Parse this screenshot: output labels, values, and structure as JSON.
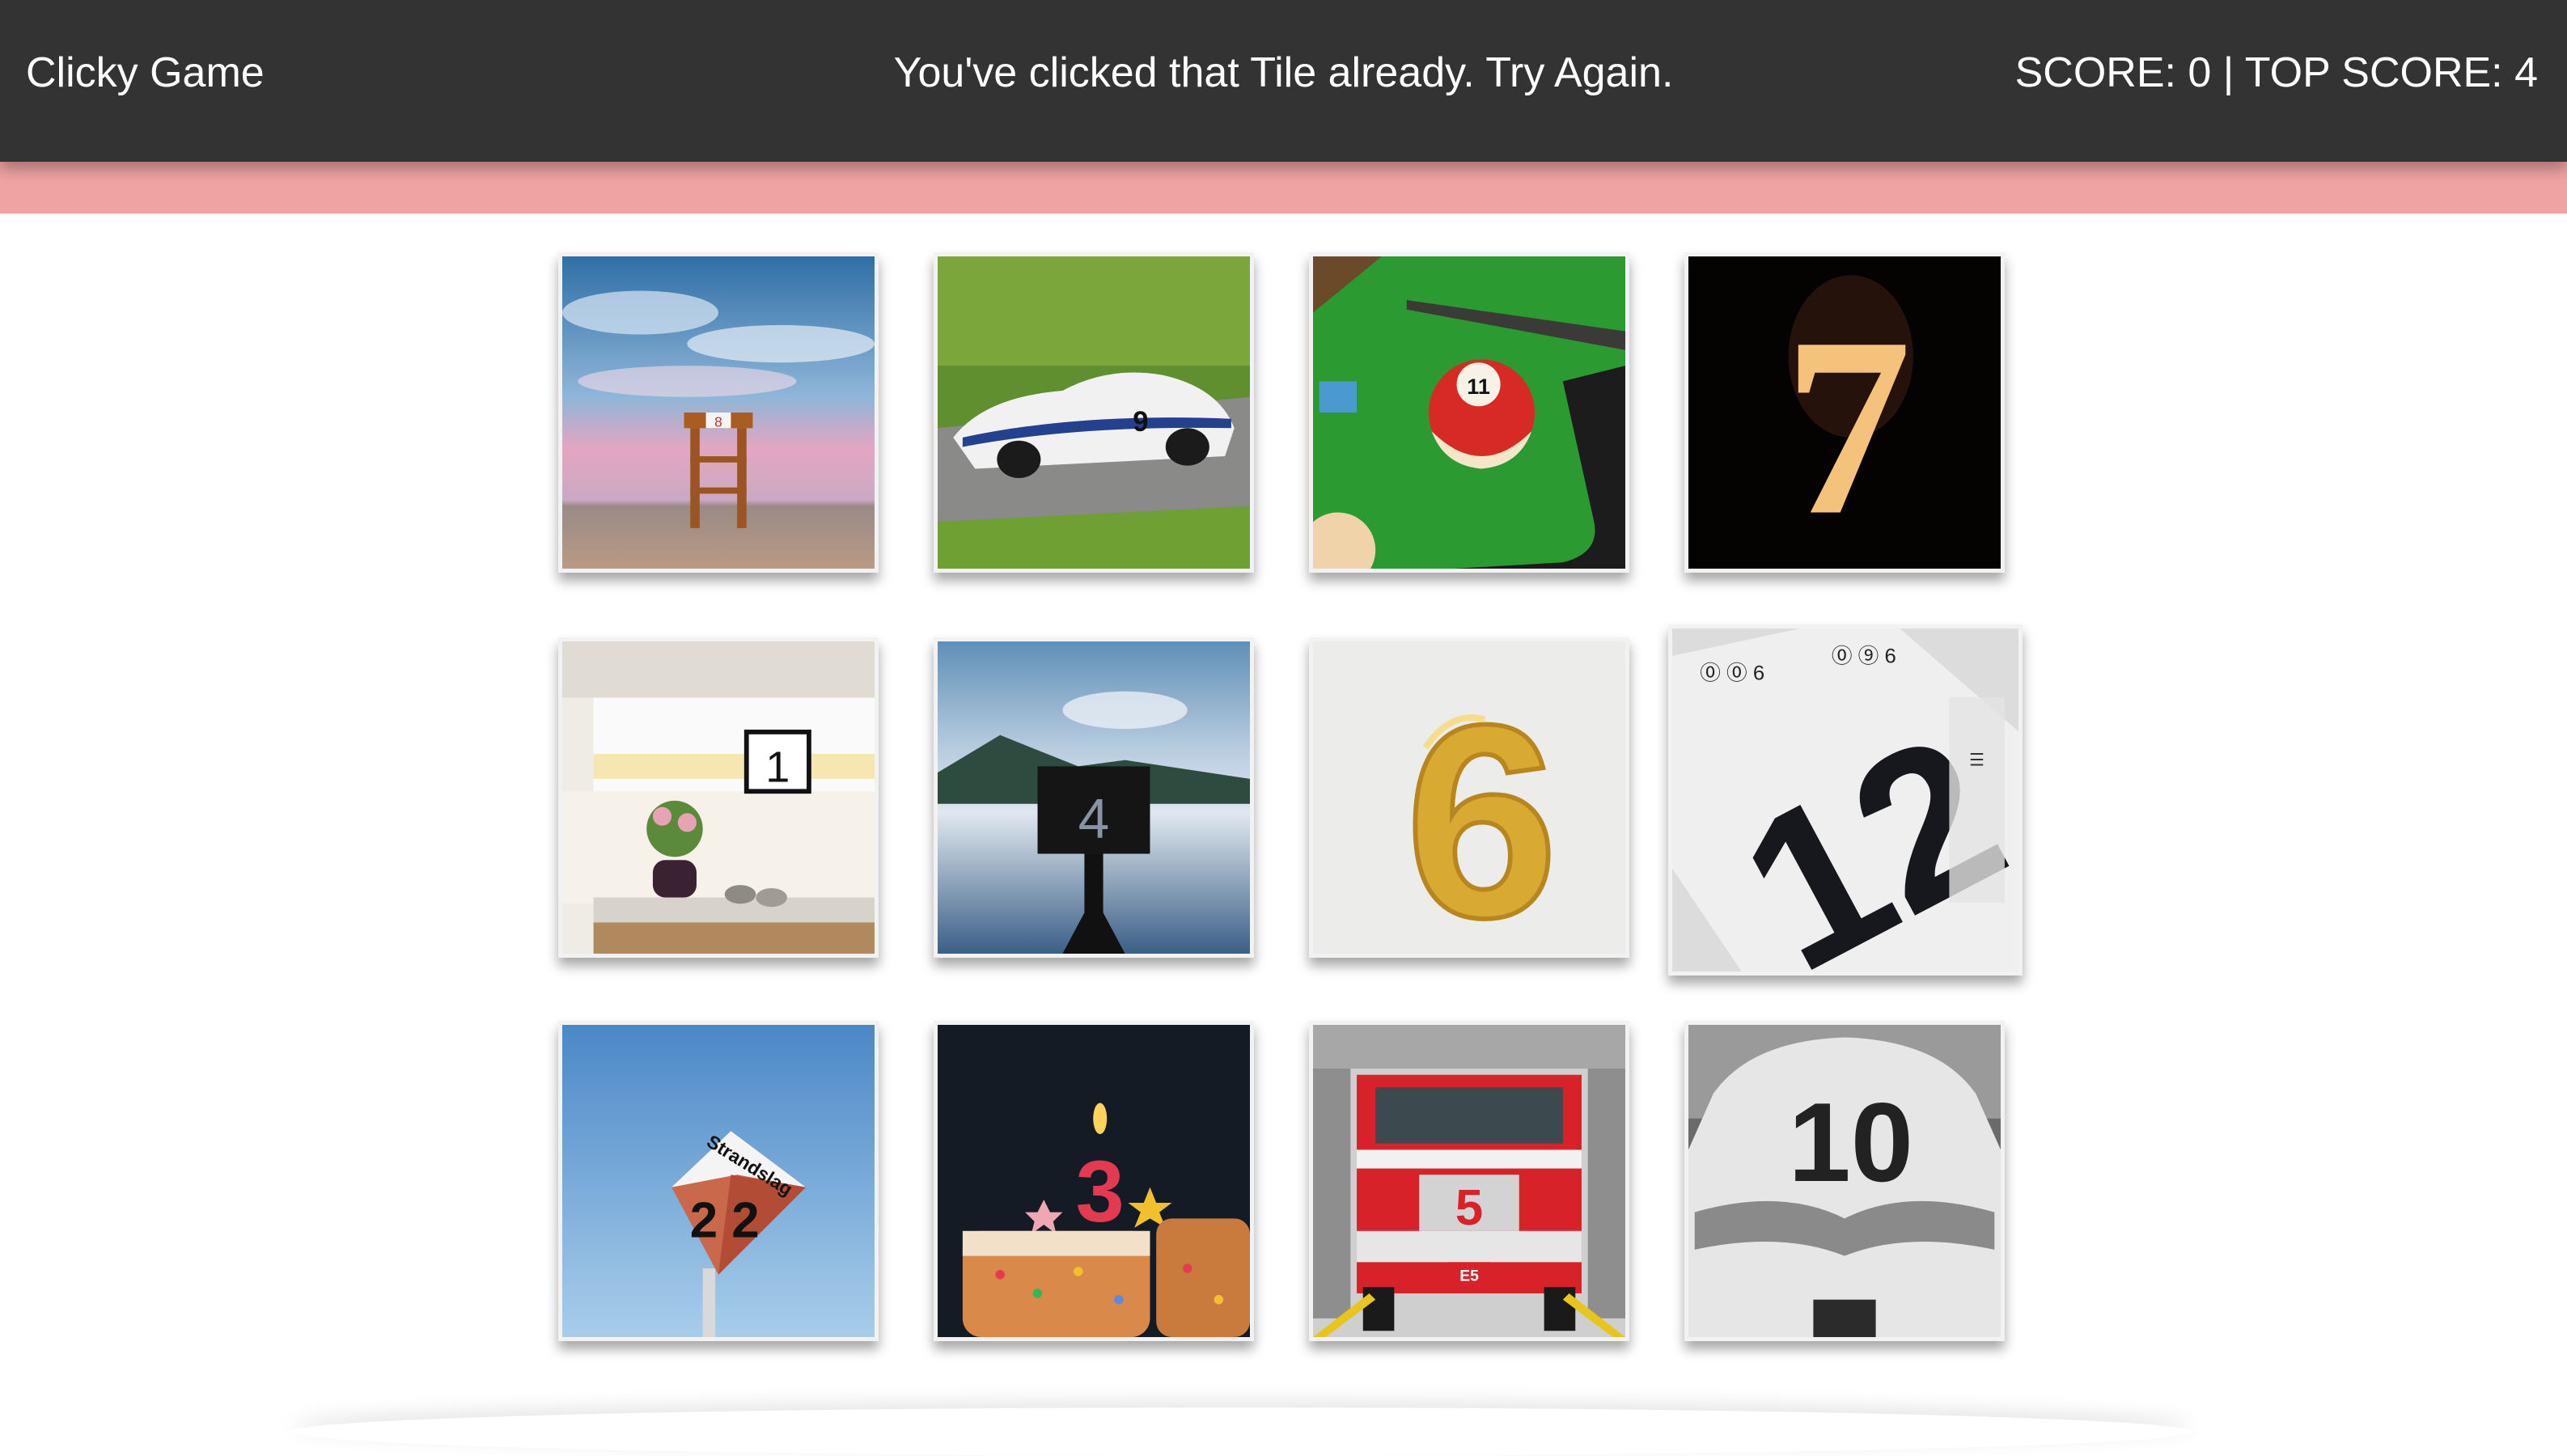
{
  "nav": {
    "brand": "Clicky Game",
    "message": "You've clicked that Tile already. Try Again.",
    "score_text": "SCORE: 0 | TOP SCORE: 4"
  },
  "colors": {
    "navbar": "#333333",
    "flash": "#f0a3a3"
  },
  "tiles": [
    {
      "image": "lifeguard-tower-8",
      "label": "8"
    },
    {
      "image": "race-car-9",
      "label": "9"
    },
    {
      "image": "billiard-ball-11",
      "label": "11"
    },
    {
      "image": "fire-number-7",
      "label": "7"
    },
    {
      "image": "window-sign-1",
      "label": "1"
    },
    {
      "image": "lake-sign-4",
      "label": "4"
    },
    {
      "image": "gold-balloon-6",
      "label": "6"
    },
    {
      "image": "newspaper-12",
      "label": "12"
    },
    {
      "image": "strandslag-sign-2",
      "label": "2 2",
      "sign_text": "Strandslag"
    },
    {
      "image": "birthday-cake-3",
      "label": "3"
    },
    {
      "image": "fire-truck-5",
      "label": "5",
      "plate_text": "E5"
    },
    {
      "image": "soccer-jersey-10",
      "label": "10"
    }
  ]
}
